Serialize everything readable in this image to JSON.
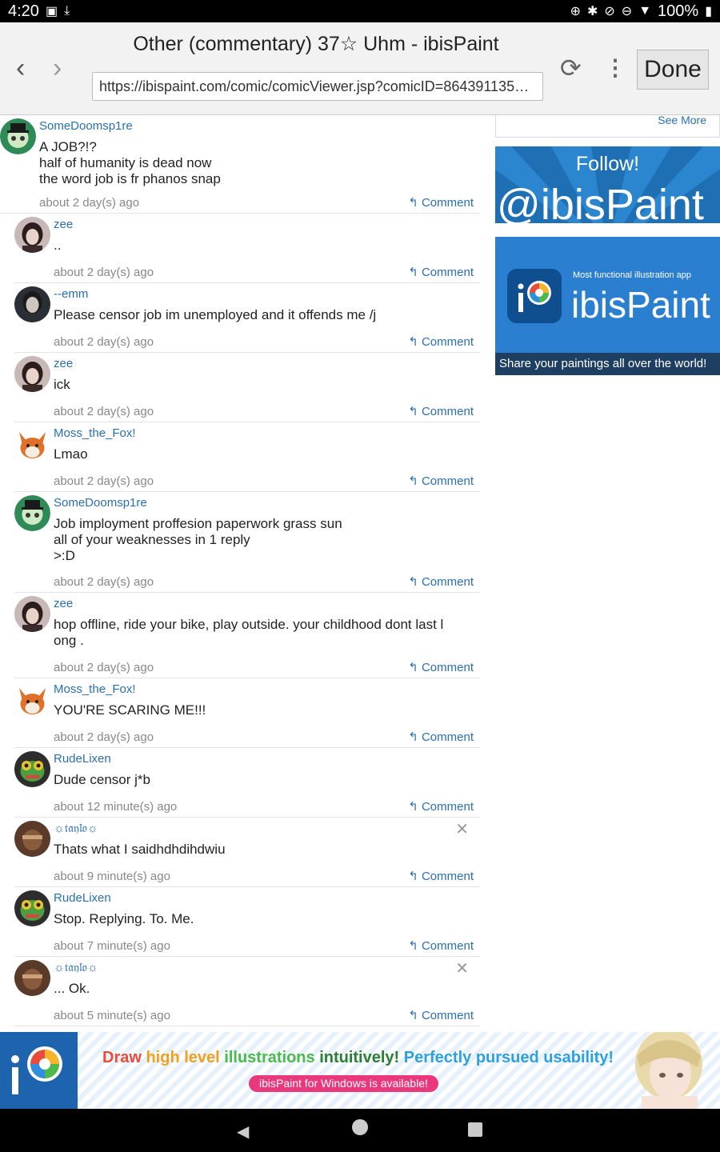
{
  "status_bar": {
    "time": "4:20",
    "battery": "100%"
  },
  "browser": {
    "title": "Other (commentary) 37☆ Uhm - ibisPaint",
    "url": "https://ibispaint.com/comic/comicViewer.jsp?comicID=864391135&...",
    "done_label": "Done"
  },
  "comments": [
    {
      "user": "SomeDoomsp1re",
      "text": "A JOB?!?\nhalf of humanity is dead now\nthe word job is fr phanos snap",
      "time": "about 2 day(s) ago",
      "reply": "Comment"
    },
    {
      "user": "zee",
      "text": "..",
      "time": "about 2 day(s) ago",
      "reply": "Comment"
    },
    {
      "user": "--emm",
      "text": "Please censor job im unemployed and it offends me /j",
      "time": "about 2 day(s) ago",
      "reply": "Comment"
    },
    {
      "user": "zee",
      "text": "ick",
      "time": "about 2 day(s) ago",
      "reply": "Comment"
    },
    {
      "user": "Moss_the_Fox!",
      "text": "Lmao",
      "time": "about 2 day(s) ago",
      "reply": "Comment"
    },
    {
      "user": "SomeDoomsp1re",
      "text": "Job imployment proffesion paperwork grass sun\nall of your weaknesses in 1 reply\n>:D",
      "time": "about 2 day(s) ago",
      "reply": "Comment"
    },
    {
      "user": "zee",
      "text": "hop offline, ride your bike, play outside. your childhood dont last l\nong .",
      "time": "about 2 day(s) ago",
      "reply": "Comment"
    },
    {
      "user": "Moss_the_Fox!",
      "text": "YOU'RE SCARING ME!!!",
      "time": "about 2 day(s) ago",
      "reply": "Comment"
    },
    {
      "user": "RudeLixen",
      "text": "Dude censor j*b",
      "time": "about 12 minute(s) ago",
      "reply": "Comment"
    },
    {
      "user": "☼𝔱𝔞𝔶𝔩𝔬☼",
      "text": "Thats what I saidhdhdihdwiu",
      "time": "about 9 minute(s) ago",
      "reply": "Comment"
    },
    {
      "user": "RudeLixen",
      "text": "Stop. Replying. To. Me.",
      "time": "about 7 minute(s) ago",
      "reply": "Comment"
    },
    {
      "user": "☼𝔱𝔞𝔶𝔩𝔬☼",
      "text": "... Ok.",
      "time": "about 5 minute(s) ago",
      "reply": "Comment"
    }
  ],
  "sidebar": {
    "see_more": "See More",
    "follow_title": "Follow!",
    "follow_handle": "@ibisPaint",
    "app_tagline": "Most functional illustration app",
    "app_name": "ibisPaint",
    "app_share": "Share your paintings all over the world!"
  },
  "ad": {
    "headline_1": "Draw ",
    "headline_2": "high level ",
    "headline_3": "illustrations ",
    "headline_4": "intuitively! ",
    "headline_5": "Perfectly pursued usability!",
    "pill": "ibisPaint for Windows is available!"
  },
  "colors": {
    "link": "#2a6fb0",
    "follow_bg": "#1f6fb5",
    "ad_pink": "#e9397c"
  }
}
